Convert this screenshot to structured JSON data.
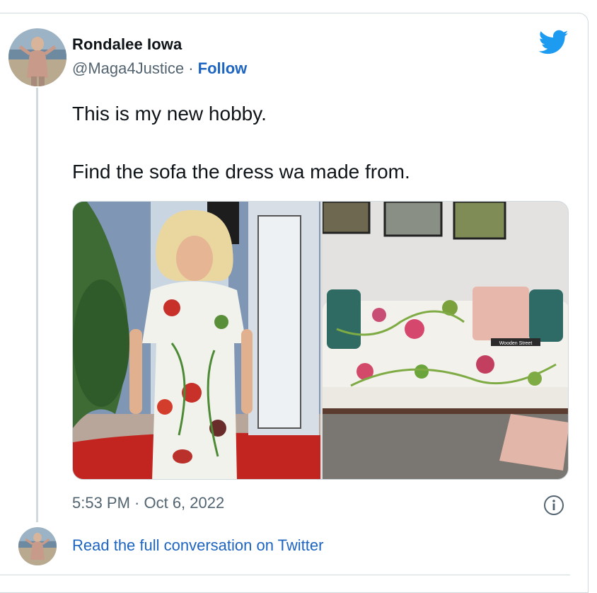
{
  "author": {
    "name": "Rondalee Iowa",
    "handle": "@Maga4Justice",
    "separator": " · ",
    "follow_label": "Follow"
  },
  "tweet": {
    "line1": "This is my new hobby.",
    "line2": "Find the sofa the dress wa made from."
  },
  "media": {
    "sofa_label": "Wooden Street"
  },
  "meta": {
    "timestamp": "5:53 PM · Oct 6, 2022"
  },
  "footer": {
    "read_link": "Read the full conversation on Twitter"
  },
  "icons": {
    "brand": "twitter-bird-icon",
    "info": "info-icon"
  },
  "colors": {
    "twitter_blue": "#1d9bf0",
    "link_blue": "#1d65c1",
    "muted_text": "#536471",
    "border": "#cfd9de"
  }
}
